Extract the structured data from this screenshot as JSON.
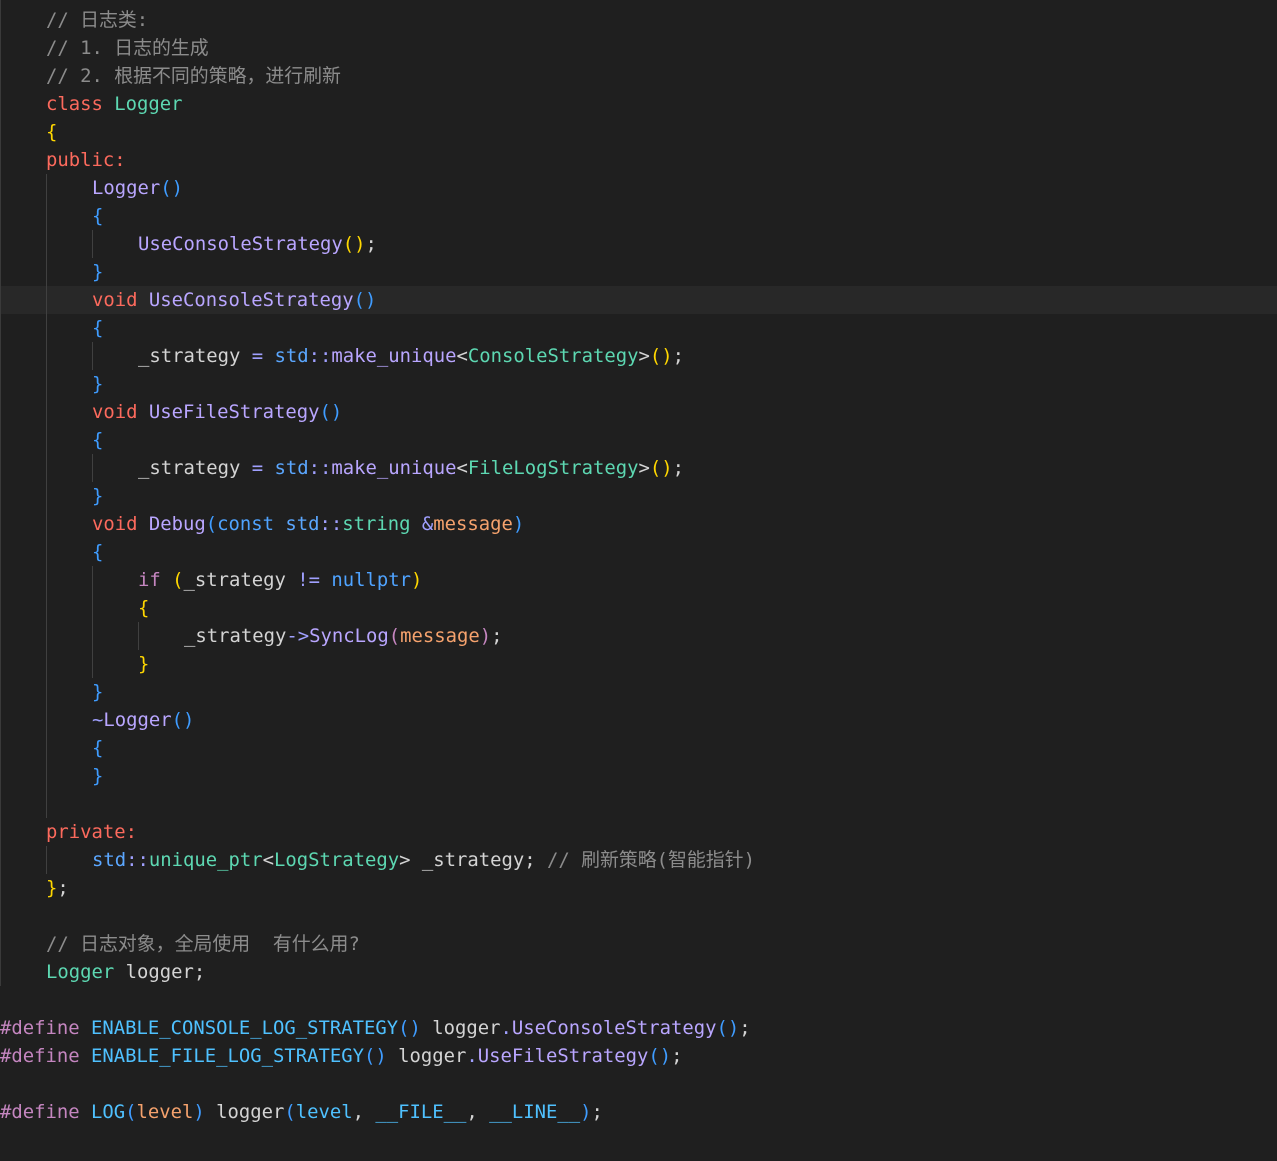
{
  "editor": {
    "language": "cpp",
    "current_line_index": 10,
    "lines": [
      {
        "indent": 1,
        "tokens": [
          {
            "t": "// 日志类:",
            "c": "comment"
          }
        ]
      },
      {
        "indent": 1,
        "tokens": [
          {
            "t": "// 1. 日志的生成",
            "c": "comment"
          }
        ]
      },
      {
        "indent": 1,
        "tokens": [
          {
            "t": "// 2. 根据不同的策略，进行刷新",
            "c": "comment"
          }
        ]
      },
      {
        "indent": 1,
        "tokens": [
          {
            "t": "class",
            "c": "keyword"
          },
          {
            "t": " ",
            "c": "plain"
          },
          {
            "t": "Logger",
            "c": "type"
          }
        ]
      },
      {
        "indent": 1,
        "tokens": [
          {
            "t": "{",
            "c": "paren1"
          }
        ]
      },
      {
        "indent": 1,
        "tokens": [
          {
            "t": "public",
            "c": "keyword"
          },
          {
            "t": ":",
            "c": "keyword"
          }
        ]
      },
      {
        "indent": 2,
        "tokens": [
          {
            "t": "Logger",
            "c": "func"
          },
          {
            "t": "()",
            "c": "brace"
          }
        ]
      },
      {
        "indent": 2,
        "tokens": [
          {
            "t": "{",
            "c": "brace"
          }
        ]
      },
      {
        "indent": 3,
        "tokens": [
          {
            "t": "UseConsoleStrategy",
            "c": "func"
          },
          {
            "t": "()",
            "c": "paren1"
          },
          {
            "t": ";",
            "c": "plain"
          }
        ]
      },
      {
        "indent": 2,
        "tokens": [
          {
            "t": "}",
            "c": "brace"
          }
        ]
      },
      {
        "indent": 2,
        "tokens": [
          {
            "t": "void",
            "c": "keyword"
          },
          {
            "t": " ",
            "c": "plain"
          },
          {
            "t": "UseConsoleStrategy",
            "c": "func"
          },
          {
            "t": "()",
            "c": "brace"
          }
        ]
      },
      {
        "indent": 2,
        "tokens": [
          {
            "t": "{",
            "c": "brace"
          }
        ]
      },
      {
        "indent": 3,
        "tokens": [
          {
            "t": "_strategy",
            "c": "plain"
          },
          {
            "t": " = ",
            "c": "op"
          },
          {
            "t": "std",
            "c": "ns"
          },
          {
            "t": "::",
            "c": "op"
          },
          {
            "t": "make_unique",
            "c": "func"
          },
          {
            "t": "<",
            "c": "plain"
          },
          {
            "t": "ConsoleStrategy",
            "c": "type"
          },
          {
            "t": ">",
            "c": "plain"
          },
          {
            "t": "()",
            "c": "paren1"
          },
          {
            "t": ";",
            "c": "plain"
          }
        ]
      },
      {
        "indent": 2,
        "tokens": [
          {
            "t": "}",
            "c": "brace"
          }
        ]
      },
      {
        "indent": 2,
        "tokens": [
          {
            "t": "void",
            "c": "keyword"
          },
          {
            "t": " ",
            "c": "plain"
          },
          {
            "t": "UseFileStrategy",
            "c": "func"
          },
          {
            "t": "()",
            "c": "brace"
          }
        ]
      },
      {
        "indent": 2,
        "tokens": [
          {
            "t": "{",
            "c": "brace"
          }
        ]
      },
      {
        "indent": 3,
        "tokens": [
          {
            "t": "_strategy",
            "c": "plain"
          },
          {
            "t": " = ",
            "c": "op"
          },
          {
            "t": "std",
            "c": "ns"
          },
          {
            "t": "::",
            "c": "op"
          },
          {
            "t": "make_unique",
            "c": "func"
          },
          {
            "t": "<",
            "c": "plain"
          },
          {
            "t": "FileLogStrategy",
            "c": "type"
          },
          {
            "t": ">",
            "c": "plain"
          },
          {
            "t": "()",
            "c": "paren1"
          },
          {
            "t": ";",
            "c": "plain"
          }
        ]
      },
      {
        "indent": 2,
        "tokens": [
          {
            "t": "}",
            "c": "brace"
          }
        ]
      },
      {
        "indent": 2,
        "tokens": [
          {
            "t": "void",
            "c": "keyword"
          },
          {
            "t": " ",
            "c": "plain"
          },
          {
            "t": "Debug",
            "c": "func"
          },
          {
            "t": "(",
            "c": "brace"
          },
          {
            "t": "const",
            "c": "kw2"
          },
          {
            "t": " ",
            "c": "plain"
          },
          {
            "t": "std",
            "c": "ns"
          },
          {
            "t": "::",
            "c": "op"
          },
          {
            "t": "string",
            "c": "type"
          },
          {
            "t": " ",
            "c": "plain"
          },
          {
            "t": "&",
            "c": "op"
          },
          {
            "t": "message",
            "c": "param"
          },
          {
            "t": ")",
            "c": "brace"
          }
        ]
      },
      {
        "indent": 2,
        "tokens": [
          {
            "t": "{",
            "c": "brace"
          }
        ]
      },
      {
        "indent": 3,
        "tokens": [
          {
            "t": "if",
            "c": "directive"
          },
          {
            "t": " ",
            "c": "plain"
          },
          {
            "t": "(",
            "c": "paren1"
          },
          {
            "t": "_strategy",
            "c": "plain"
          },
          {
            "t": " != ",
            "c": "op"
          },
          {
            "t": "nullptr",
            "c": "kw2"
          },
          {
            "t": ")",
            "c": "paren1"
          }
        ]
      },
      {
        "indent": 3,
        "tokens": [
          {
            "t": "{",
            "c": "paren1"
          }
        ]
      },
      {
        "indent": 4,
        "tokens": [
          {
            "t": "_strategy",
            "c": "plain"
          },
          {
            "t": "->",
            "c": "op"
          },
          {
            "t": "SyncLog",
            "c": "func"
          },
          {
            "t": "(",
            "c": "directive"
          },
          {
            "t": "message",
            "c": "param"
          },
          {
            "t": ")",
            "c": "directive"
          },
          {
            "t": ";",
            "c": "plain"
          }
        ]
      },
      {
        "indent": 3,
        "tokens": [
          {
            "t": "}",
            "c": "paren1"
          }
        ]
      },
      {
        "indent": 2,
        "tokens": [
          {
            "t": "}",
            "c": "brace"
          }
        ]
      },
      {
        "indent": 2,
        "tokens": [
          {
            "t": "~",
            "c": "op"
          },
          {
            "t": "Logger",
            "c": "func"
          },
          {
            "t": "()",
            "c": "brace"
          }
        ]
      },
      {
        "indent": 2,
        "tokens": [
          {
            "t": "{",
            "c": "brace"
          }
        ]
      },
      {
        "indent": 2,
        "tokens": [
          {
            "t": "}",
            "c": "brace"
          }
        ]
      },
      {
        "indent": 0,
        "tokens": []
      },
      {
        "indent": 1,
        "tokens": [
          {
            "t": "private",
            "c": "keyword"
          },
          {
            "t": ":",
            "c": "keyword"
          }
        ]
      },
      {
        "indent": 2,
        "tokens": [
          {
            "t": "std",
            "c": "ns"
          },
          {
            "t": "::",
            "c": "op"
          },
          {
            "t": "unique_ptr",
            "c": "type"
          },
          {
            "t": "<",
            "c": "plain"
          },
          {
            "t": "LogStrategy",
            "c": "type"
          },
          {
            "t": ">",
            "c": "plain"
          },
          {
            "t": " _strategy; ",
            "c": "plain"
          },
          {
            "t": "// 刷新策略(智能指针)",
            "c": "comment"
          }
        ]
      },
      {
        "indent": 1,
        "tokens": [
          {
            "t": "}",
            "c": "paren1"
          },
          {
            "t": ";",
            "c": "plain"
          }
        ]
      },
      {
        "indent": 0,
        "tokens": []
      },
      {
        "indent": 1,
        "tokens": [
          {
            "t": "// 日志对象，全局使用  有什么用?",
            "c": "comment"
          }
        ]
      },
      {
        "indent": 1,
        "tokens": [
          {
            "t": "Logger",
            "c": "type"
          },
          {
            "t": " logger;",
            "c": "plain"
          }
        ]
      },
      {
        "indent": 0,
        "tokens": []
      },
      {
        "indent": 0,
        "tokens": [
          {
            "t": "#define",
            "c": "directive"
          },
          {
            "t": " ",
            "c": "plain"
          },
          {
            "t": "ENABLE_CONSOLE_LOG_STRATEGY",
            "c": "macro"
          },
          {
            "t": "()",
            "c": "brace"
          },
          {
            "t": " logger",
            "c": "plain"
          },
          {
            "t": ".",
            "c": "op"
          },
          {
            "t": "UseConsoleStrategy",
            "c": "func"
          },
          {
            "t": "()",
            "c": "brace"
          },
          {
            "t": ";",
            "c": "plain"
          }
        ]
      },
      {
        "indent": 0,
        "tokens": [
          {
            "t": "#define",
            "c": "directive"
          },
          {
            "t": " ",
            "c": "plain"
          },
          {
            "t": "ENABLE_FILE_LOG_STRATEGY",
            "c": "macro"
          },
          {
            "t": "()",
            "c": "brace"
          },
          {
            "t": " logger",
            "c": "plain"
          },
          {
            "t": ".",
            "c": "op"
          },
          {
            "t": "UseFileStrategy",
            "c": "func"
          },
          {
            "t": "()",
            "c": "brace"
          },
          {
            "t": ";",
            "c": "plain"
          }
        ]
      },
      {
        "indent": 0,
        "tokens": []
      },
      {
        "indent": 0,
        "tokens": [
          {
            "t": "#define",
            "c": "directive"
          },
          {
            "t": " ",
            "c": "plain"
          },
          {
            "t": "LOG",
            "c": "macro"
          },
          {
            "t": "(",
            "c": "brace"
          },
          {
            "t": "level",
            "c": "param"
          },
          {
            "t": ")",
            "c": "brace"
          },
          {
            "t": " logger",
            "c": "plain"
          },
          {
            "t": "(",
            "c": "brace"
          },
          {
            "t": "level",
            "c": "macro"
          },
          {
            "t": ", ",
            "c": "plain"
          },
          {
            "t": "__FILE__",
            "c": "macro"
          },
          {
            "t": ", ",
            "c": "plain"
          },
          {
            "t": "__LINE__",
            "c": "macro"
          },
          {
            "t": ")",
            "c": "brace"
          },
          {
            "t": ";",
            "c": "plain"
          }
        ]
      }
    ]
  },
  "colors": {
    "background": "#1f1f1f",
    "current_line": "#282828",
    "comment": "#8c8c8c",
    "keyword": "#fc6a5d",
    "type": "#5dd8b2",
    "func": "#b9a6ff",
    "brace": "#3f9cff",
    "paren1": "#ffd700",
    "macro": "#4fc1ff",
    "param": "#f5a26d"
  }
}
